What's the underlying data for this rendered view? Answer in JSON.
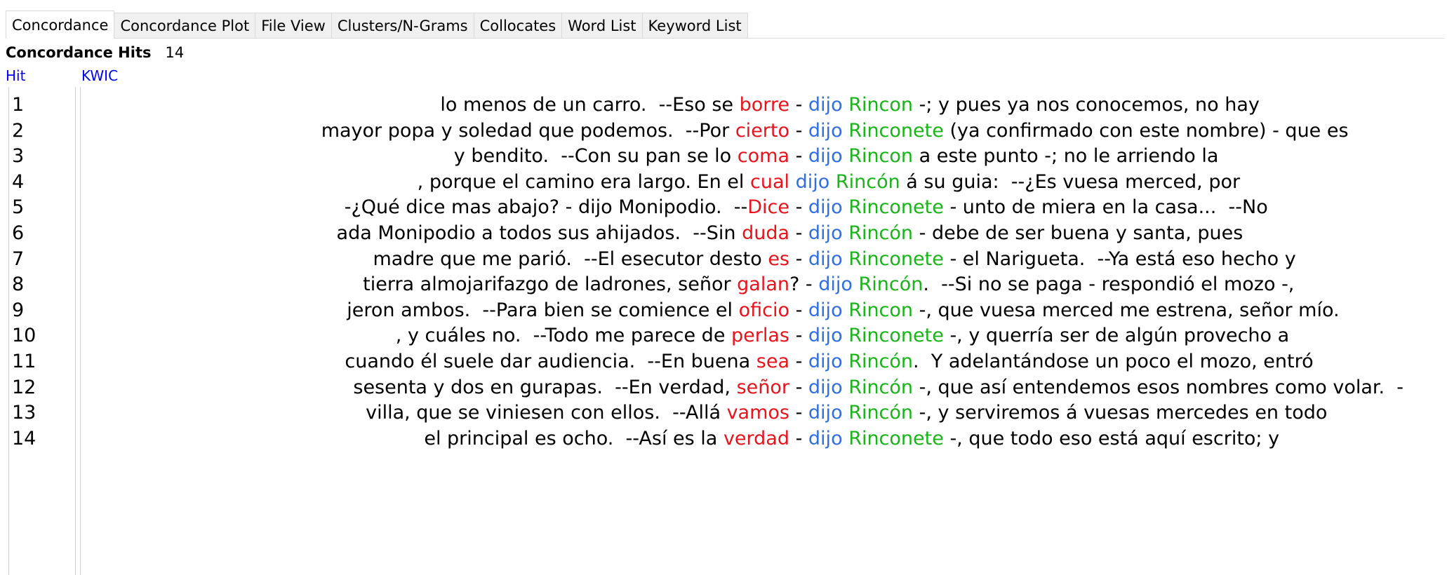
{
  "tabs": [
    {
      "label": "Concordance",
      "active": true
    },
    {
      "label": "Concordance Plot",
      "active": false
    },
    {
      "label": "File View",
      "active": false
    },
    {
      "label": "Clusters/N-Grams",
      "active": false
    },
    {
      "label": "Collocates",
      "active": false
    },
    {
      "label": "Word List",
      "active": false
    },
    {
      "label": "Keyword List",
      "active": false
    }
  ],
  "hits": {
    "label": "Concordance Hits",
    "count": "14"
  },
  "columns": {
    "hit": "Hit",
    "kwic": "KWIC"
  },
  "colors": {
    "keyword": "#e8131b",
    "dijo": "#2f6fe0",
    "speaker": "#18b418",
    "header": "#0000ff"
  },
  "rows": [
    {
      "num": "1",
      "left": "lo menos de un carro.  --Eso se ",
      "kw": "borre",
      "sep": " - ",
      "dijo": "dijo",
      "speaker": "Rincon",
      "rest": " -; y pues ya nos conocemos, no hay"
    },
    {
      "num": "2",
      "left": "mayor popa y soledad que podemos.  --Por ",
      "kw": "cierto",
      "sep": " - ",
      "dijo": "dijo",
      "speaker": "Rinconete",
      "rest": " (ya confirmado con este nombre) - que es"
    },
    {
      "num": "3",
      "left": "y bendito.  --Con su pan se lo ",
      "kw": "coma",
      "sep": " - ",
      "dijo": "dijo",
      "speaker": "Rincon",
      "rest": " a este punto -; no le arriendo la"
    },
    {
      "num": "4",
      "left": ", porque el camino era largo. En el ",
      "kw": "cual",
      "sep": " ",
      "dijo": "dijo",
      "speaker": "Rincón",
      "rest": " á su guia:  --¿Es vuesa merced, por"
    },
    {
      "num": "5",
      "left": "-¿Qué dice mas abajo? - dijo Monipodio.  --",
      "kw": "Dice",
      "sep": " - ",
      "dijo": "dijo",
      "speaker": "Rinconete",
      "rest": " - unto de miera en la casa...  --No"
    },
    {
      "num": "6",
      "left": "ada Monipodio a todos sus ahijados.  --Sin ",
      "kw": "duda",
      "sep": " - ",
      "dijo": "dijo",
      "speaker": "Rincón",
      "rest": " - debe de ser buena y santa, pues"
    },
    {
      "num": "7",
      "left": "madre que me parió.  --El esecutor desto ",
      "kw": "es",
      "sep": " - ",
      "dijo": "dijo",
      "speaker": "Rinconete",
      "rest": " - el Narigueta.  --Ya está eso hecho y"
    },
    {
      "num": "8",
      "left": "tierra almojarifazgo de ladrones, señor ",
      "kw": "galan",
      "sep": "? - ",
      "dijo": "dijo",
      "speaker": "Rincón",
      "rest": ".  --Si no se paga - respondió el mozo -,"
    },
    {
      "num": "9",
      "left": "jeron ambos.  --Para bien se comience el ",
      "kw": "oficio",
      "sep": " - ",
      "dijo": "dijo",
      "speaker": "Rincon",
      "rest": " -, que vuesa merced me estrena, señor mío."
    },
    {
      "num": "10",
      "left": ", y cuáles no.  --Todo me parece de ",
      "kw": "perlas",
      "sep": " - ",
      "dijo": "dijo",
      "speaker": "Rinconete",
      "rest": " -, y querría ser de algún provecho a"
    },
    {
      "num": "11",
      "left": "cuando él suele dar audiencia.  --En buena ",
      "kw": "sea",
      "sep": " - ",
      "dijo": "dijo",
      "speaker": "Rincón",
      "rest": ".  Y adelantándose un poco el mozo, entró"
    },
    {
      "num": "12",
      "left": "sesenta y dos en gurapas.  --En verdad, ",
      "kw": "señor",
      "sep": " - ",
      "dijo": "dijo",
      "speaker": "Rincón",
      "rest": " -, que así entendemos esos nombres como volar.  -"
    },
    {
      "num": "13",
      "left": "villa, que se viniesen con ellos.  --Allá ",
      "kw": "vamos",
      "sep": " - ",
      "dijo": "dijo",
      "speaker": "Rincón",
      "rest": " -, y serviremos á vuesas mercedes en todo"
    },
    {
      "num": "14",
      "left": "el principal es ocho.  --Así es la ",
      "kw": "verdad",
      "sep": " - ",
      "dijo": "dijo",
      "speaker": "Rinconete",
      "rest": " -, que todo eso está aquí escrito; y"
    }
  ]
}
